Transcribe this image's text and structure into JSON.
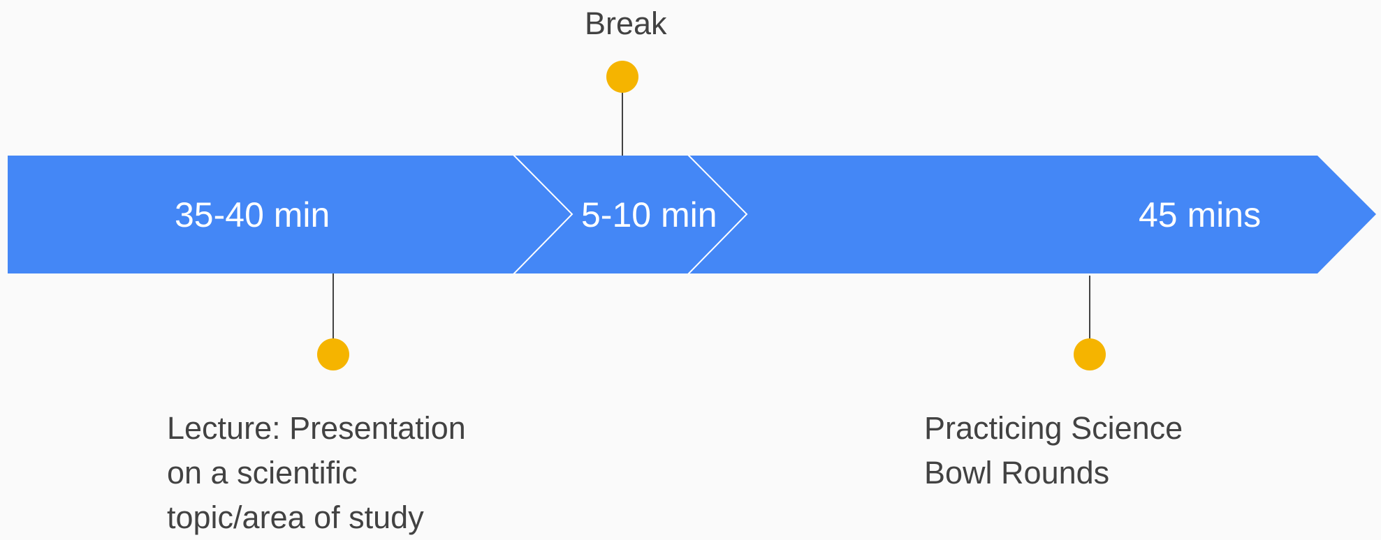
{
  "timeline": {
    "colors": {
      "bar": "#4487f6",
      "separator": "#ffffff",
      "marker": "#f5b400",
      "connector": "#424242",
      "text": "#424242",
      "background": "#fafafa"
    },
    "segments": [
      {
        "duration": "35-40 min"
      },
      {
        "duration": "5-10 min"
      },
      {
        "duration": "45 mins"
      }
    ],
    "events": [
      {
        "lines": [
          "Break"
        ]
      },
      {
        "lines": [
          "Lecture: Presentation",
          "on a scientific",
          "topic/area of study"
        ]
      },
      {
        "lines": [
          "Practicing Science",
          "Bowl Rounds"
        ]
      }
    ]
  }
}
